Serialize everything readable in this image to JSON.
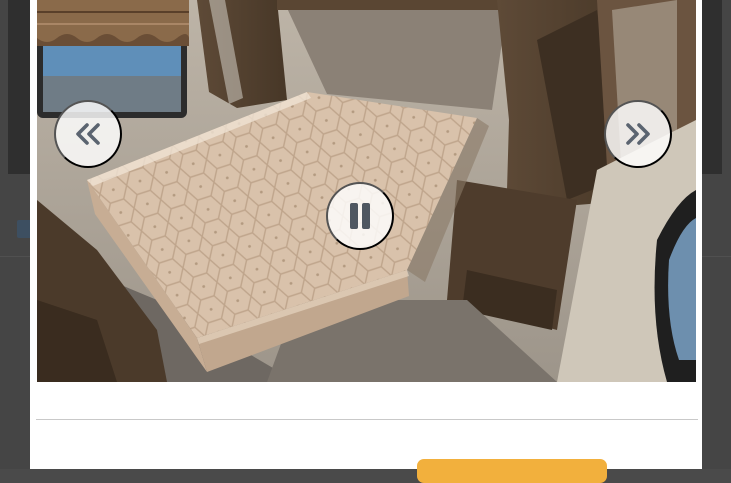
{
  "gallery": {
    "image_alt_subject": "",
    "controls": {
      "previous_icon": "double-chevron-left-icon",
      "next_icon": "double-chevron-right-icon",
      "pause_icon": "pause-icon"
    }
  },
  "footer": {
    "primary_button_label": ""
  },
  "colors": {
    "accent": "#f2b03d",
    "modal_background": "#ffffff",
    "backdrop": "#454545",
    "control_background": "#ffffffd1"
  }
}
